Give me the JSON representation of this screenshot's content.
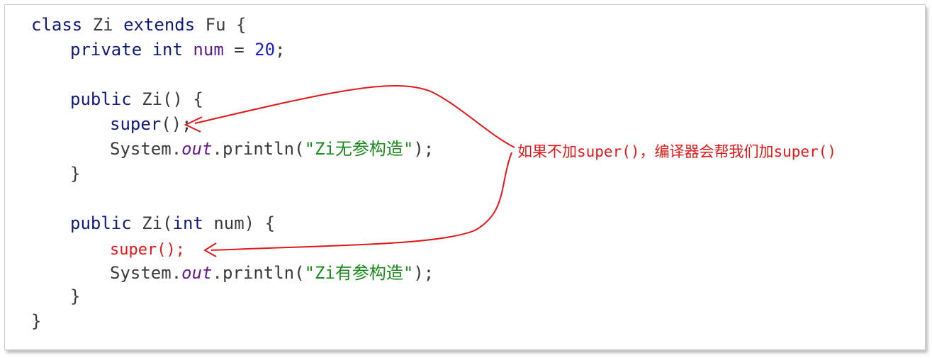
{
  "code": {
    "l1": {
      "kw_class": "class",
      "name": "Zi",
      "kw_extends": "extends",
      "parent": "Fu",
      "brace": "{"
    },
    "l2": {
      "kw_private": "private",
      "kw_int": "int",
      "field": "num",
      "eq": "=",
      "value": "20",
      "semi": ";"
    },
    "l3": {
      "kw_public": "public",
      "sig": "Zi()",
      "brace": "{"
    },
    "l4": {
      "call": "super",
      "rest": "();"
    },
    "l5": {
      "system": "System.",
      "out": "out",
      "println": ".println(",
      "str": "\"Zi无参构造\"",
      "end": ");"
    },
    "l6": {
      "brace": "}"
    },
    "l7": {
      "kw_public": "public",
      "sig1": "Zi(",
      "kw_int": "int",
      "sig2": "num)",
      "brace": "{"
    },
    "l8": {
      "call": "super();"
    },
    "l9": {
      "system": "System.",
      "out": "out",
      "println": ".println(",
      "str": "\"Zi有参构造\"",
      "end": ");"
    },
    "l10": {
      "brace": "}"
    },
    "l11": {
      "brace": "}"
    }
  },
  "annotation": {
    "text": "如果不加super()，编译器会帮我们加super()"
  },
  "colors": {
    "keyword": "#0f1a7a",
    "number": "#1a22c8",
    "string": "#1c8a1c",
    "annotation": "#e01818"
  }
}
